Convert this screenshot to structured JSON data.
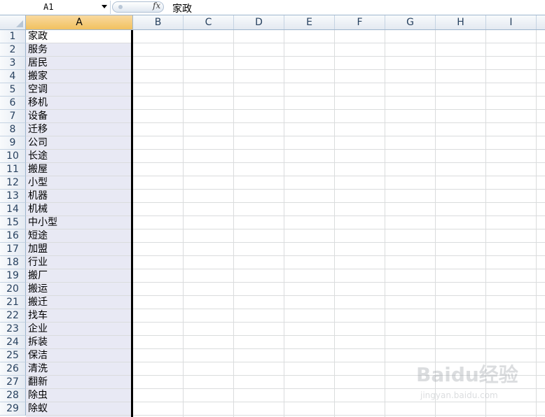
{
  "formula_bar": {
    "name_box": "A1",
    "fx_label": "fx",
    "content": "家政"
  },
  "columns": [
    "A",
    "B",
    "C",
    "D",
    "E",
    "F",
    "G",
    "H",
    "I"
  ],
  "selected_column": "A",
  "rows": [
    {
      "num": "1",
      "a": "家政"
    },
    {
      "num": "2",
      "a": "服务"
    },
    {
      "num": "3",
      "a": "居民"
    },
    {
      "num": "4",
      "a": "搬家"
    },
    {
      "num": "5",
      "a": "空调"
    },
    {
      "num": "6",
      "a": "移机"
    },
    {
      "num": "7",
      "a": "设备"
    },
    {
      "num": "8",
      "a": "迁移"
    },
    {
      "num": "9",
      "a": "公司"
    },
    {
      "num": "10",
      "a": "长途"
    },
    {
      "num": "11",
      "a": "搬屋"
    },
    {
      "num": "12",
      "a": "小型"
    },
    {
      "num": "13",
      "a": "机器"
    },
    {
      "num": "14",
      "a": "机械"
    },
    {
      "num": "15",
      "a": "中小型"
    },
    {
      "num": "16",
      "a": "短途"
    },
    {
      "num": "17",
      "a": "加盟"
    },
    {
      "num": "18",
      "a": "行业"
    },
    {
      "num": "19",
      "a": "搬厂"
    },
    {
      "num": "20",
      "a": "搬运"
    },
    {
      "num": "21",
      "a": "搬迁"
    },
    {
      "num": "22",
      "a": "找车"
    },
    {
      "num": "23",
      "a": "企业"
    },
    {
      "num": "24",
      "a": "拆装"
    },
    {
      "num": "25",
      "a": "保洁"
    },
    {
      "num": "26",
      "a": "清洗"
    },
    {
      "num": "27",
      "a": "翻新"
    },
    {
      "num": "28",
      "a": "除虫"
    },
    {
      "num": "29",
      "a": "除蚁"
    }
  ],
  "watermark": {
    "text": "Baidu经验",
    "sub": "jingyan.baidu.com"
  },
  "colors": {
    "header_border": "#9eb6ce",
    "selection_fill": "#e8e9f4",
    "selected_header": "#f1c15f"
  }
}
